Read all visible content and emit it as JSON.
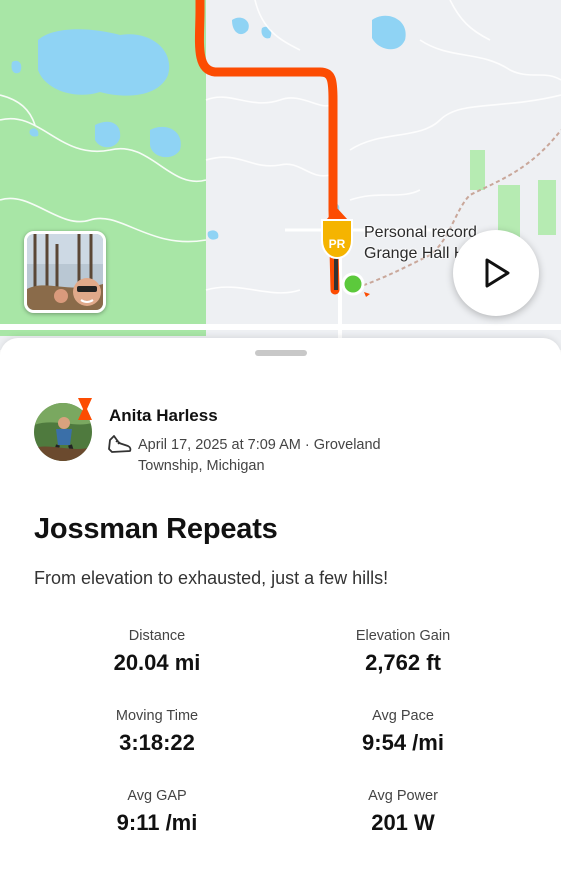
{
  "map": {
    "pr_label_line1": "Personal record",
    "pr_label_line2": "Grange Hall Hill Climb",
    "pr_marker_text": "PR",
    "route_color": "#fc4c02",
    "forest_color": "#a8e6a6",
    "water_color": "#8fd3f4"
  },
  "controls": {
    "play_icon": "play-icon"
  },
  "activity": {
    "athlete_name": "Anita  Harless",
    "activity_icon": "shoe-icon",
    "date_location": "April 17, 2025 at 7:09 AM · Groveland Township, Michigan",
    "title": "Jossman Repeats",
    "description": "From elevation to exhausted, just a few hills!"
  },
  "stats": [
    {
      "label": "Distance",
      "value": "20.04 mi"
    },
    {
      "label": "Elevation Gain",
      "value": "2,762 ft"
    },
    {
      "label": "Moving Time",
      "value": "3:18:22"
    },
    {
      "label": "Avg Pace",
      "value": "9:54 /mi"
    },
    {
      "label": "Avg GAP",
      "value": "9:11 /mi"
    },
    {
      "label": "Avg Power",
      "value": "201 W"
    }
  ],
  "colors": {
    "brand": "#fc4c02",
    "pr_gold": "#f5b400",
    "start_green": "#5cc93c"
  }
}
